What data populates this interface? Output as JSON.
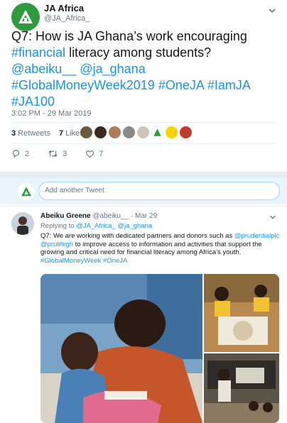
{
  "tweet": {
    "author_name": "JA Africa",
    "author_handle": "@JA_Africa_",
    "text_lines": [
      [
        {
          "t": "Q7: How is JA Ghana’s work encouraging",
          "link": false
        }
      ],
      [
        {
          "t": "#financial",
          "link": true
        },
        {
          "t": " literacy among students?",
          "link": false
        }
      ],
      [
        {
          "t": "@abeiku__",
          "link": true
        },
        {
          "t": " ",
          "link": false
        },
        {
          "t": "@ja_ghana",
          "link": true
        }
      ],
      [
        {
          "t": "#GlobalMoneyWeek2019",
          "link": true
        },
        {
          "t": " ",
          "link": false
        },
        {
          "t": "#OneJA",
          "link": true
        },
        {
          "t": " ",
          "link": false
        },
        {
          "t": "#IamJA",
          "link": true
        }
      ],
      [
        {
          "t": "#JA100",
          "link": true
        }
      ]
    ],
    "timestamp": "3:02 PM - 29 Mar 2019",
    "retweets_count": "3",
    "retweets_label": "Retweets",
    "likes_count": "7",
    "likes_label": "Likes",
    "reply_count": "2",
    "retweet_count": "3",
    "like_count": "7"
  },
  "compose": {
    "placeholder": "Add another Tweet"
  },
  "reply": {
    "author_name": "Abeiku Greene",
    "author_handle": "@abeiku__",
    "dot": "·",
    "date": "Mar 29",
    "replying_prefix": "Replying to",
    "replying_to": "@JA_Africa_ @ja_ghana",
    "text_lines": [
      [
        {
          "t": "Q7: We are working with dedicated partners and donors such as ",
          "link": false
        },
        {
          "t": "@prudentialplc",
          "link": true
        }
      ],
      [
        {
          "t": "@prulifegh",
          "link": true
        },
        {
          "t": " to improve access to information and activities that support the",
          "link": false
        }
      ],
      [
        {
          "t": "growing and critical need for financial literacy among Africa’s youth.",
          "link": false
        }
      ],
      [
        {
          "t": "#GlobalMoneyWeek",
          "link": true
        },
        {
          "t": " ",
          "link": false
        },
        {
          "t": "#OneJA",
          "link": true
        }
      ]
    ]
  },
  "colors": {
    "brand_green": "#2e9b3f",
    "link_blue": "#1b95e0",
    "secondary_text": "#657786"
  },
  "icons": {
    "chevron": "chevron-down-icon",
    "reply": "reply-icon",
    "retweet": "retweet-icon",
    "like": "heart-icon",
    "logo": "ja-logo-icon"
  }
}
